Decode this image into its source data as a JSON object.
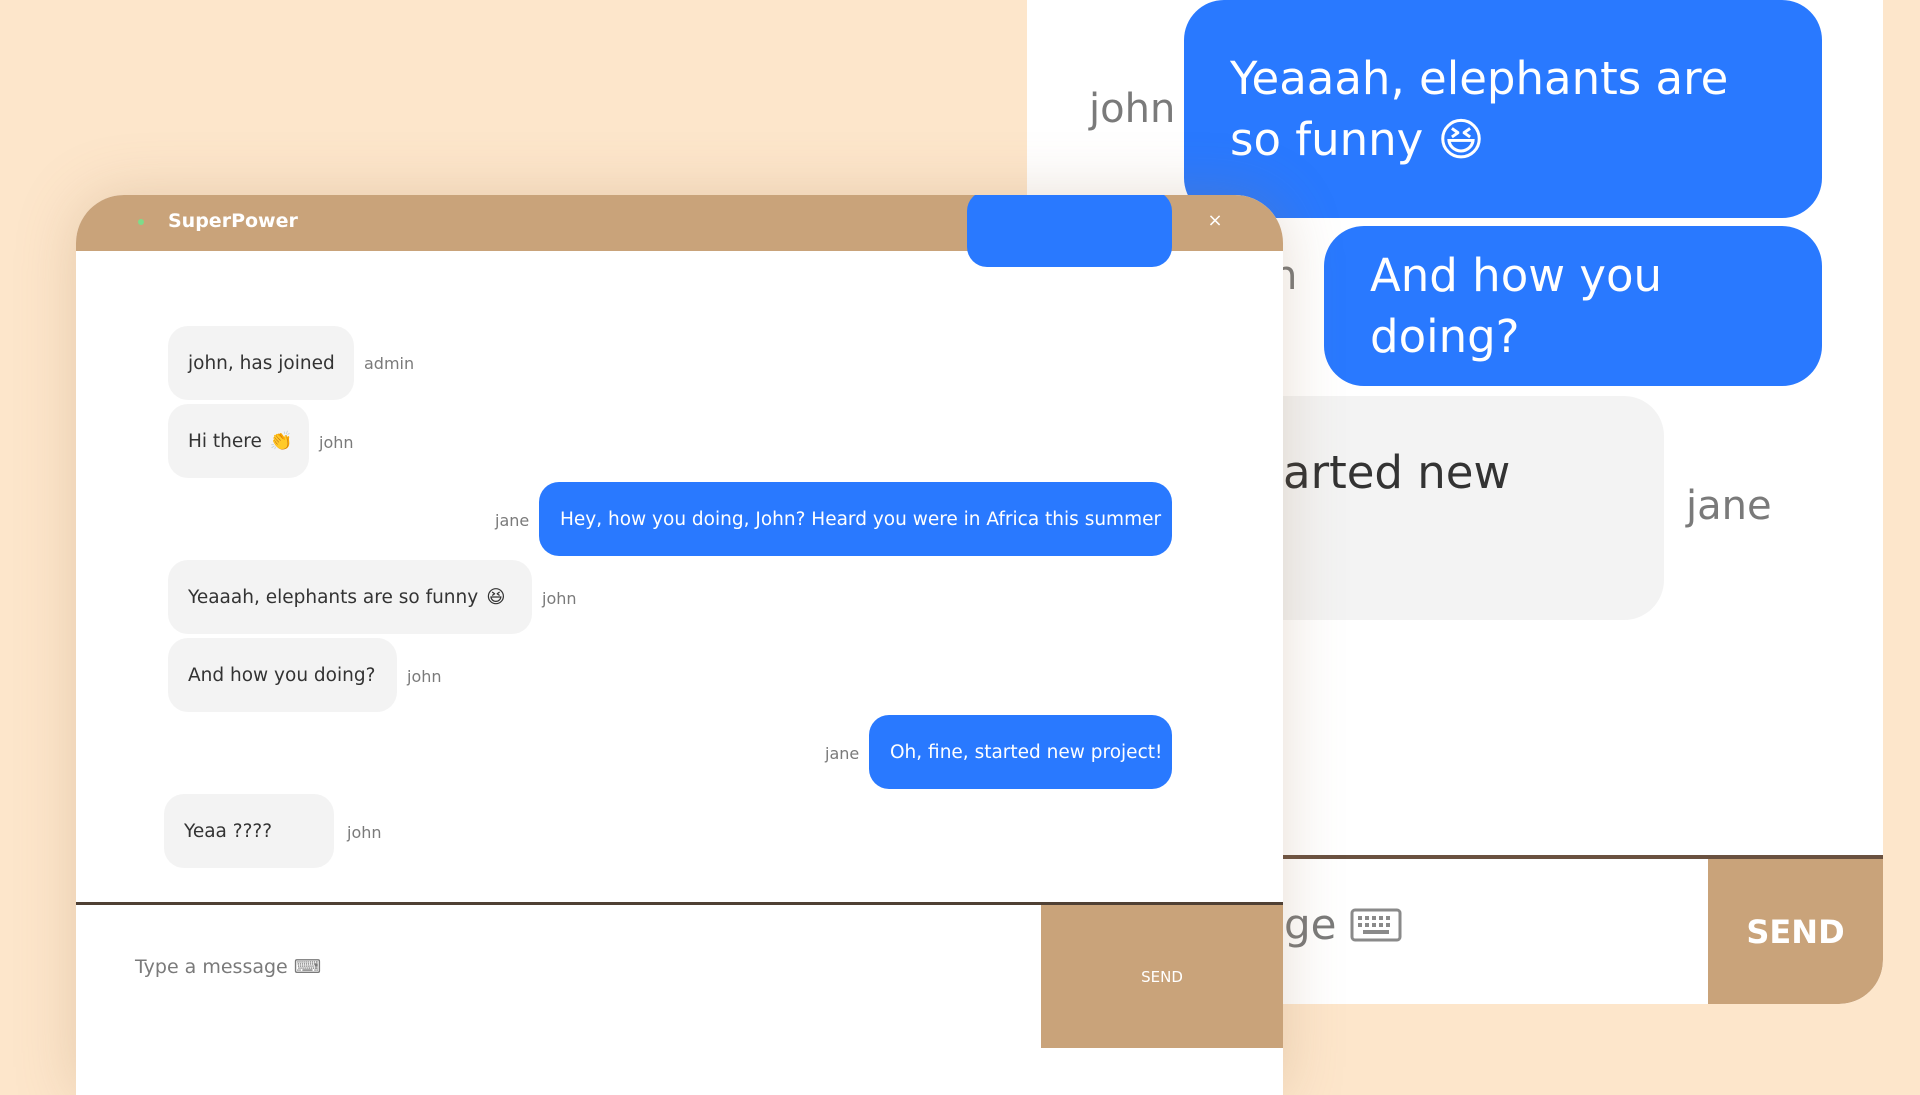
{
  "background_window": {
    "messages": [
      {
        "sender": "john",
        "text": "Yeaaah, elephants are so funny 😆",
        "style": "blue"
      },
      {
        "sender": "n",
        "text": "And how you doing?",
        "style": "blue"
      },
      {
        "sender": "jane",
        "text": "arted new",
        "style": "gray"
      }
    ],
    "input_text": "ge",
    "send_label": "SEND"
  },
  "chat": {
    "title": "SuperPower",
    "close_label": "×",
    "messages": [
      {
        "text": "john, has joined",
        "sender": "admin",
        "style": "gray"
      },
      {
        "text": "Hi there",
        "emoji": "👏",
        "sender": "john",
        "style": "gray"
      },
      {
        "text": "Hey, how you doing, John? Heard you were in Africa this summer",
        "sender": "jane",
        "style": "blue"
      },
      {
        "text": "Yeaaah, elephants are so funny",
        "emoji": "😆",
        "sender": "john",
        "style": "gray"
      },
      {
        "text": "And how you doing?",
        "sender": "john",
        "style": "gray"
      },
      {
        "text": "Oh, fine, started new project!",
        "sender": "jane",
        "style": "blue"
      },
      {
        "text": "Yeaa ????",
        "sender": "john",
        "style": "gray"
      }
    ],
    "input_placeholder": "Type a message ⌨",
    "send_label": "SEND"
  },
  "colors": {
    "page_bg": "#fde6cb",
    "accent": "#c9a37a",
    "bubble_blue": "#2979ff",
    "bubble_gray": "#f3f3f3",
    "online_dot": "#7ddc8a"
  },
  "icons": [
    "status-dot-icon",
    "close-icon",
    "keyboard-icon",
    "clap-emoji-icon",
    "laughing-emoji-icon"
  ]
}
